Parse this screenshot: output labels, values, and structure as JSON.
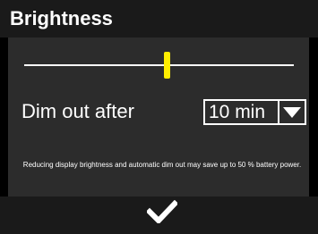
{
  "header": {
    "title": "Brightness"
  },
  "brightness_slider": {
    "level": 0.53,
    "thumb_color": "#ffee00",
    "track_color": "#ffffff"
  },
  "dim_out": {
    "label": "Dim out after",
    "selected_value": "10 min",
    "arrow_icon": "triangle-down-icon"
  },
  "note": {
    "text": "Reducing display brightness and automatic dim out may save up to 50 % battery power."
  },
  "footer": {
    "confirm_icon": "checkmark-icon"
  },
  "colors": {
    "background": "#000000",
    "panel": "#2c2c2c",
    "header": "#1a1a1a",
    "text": "#ffffff",
    "accent": "#ffee00"
  }
}
